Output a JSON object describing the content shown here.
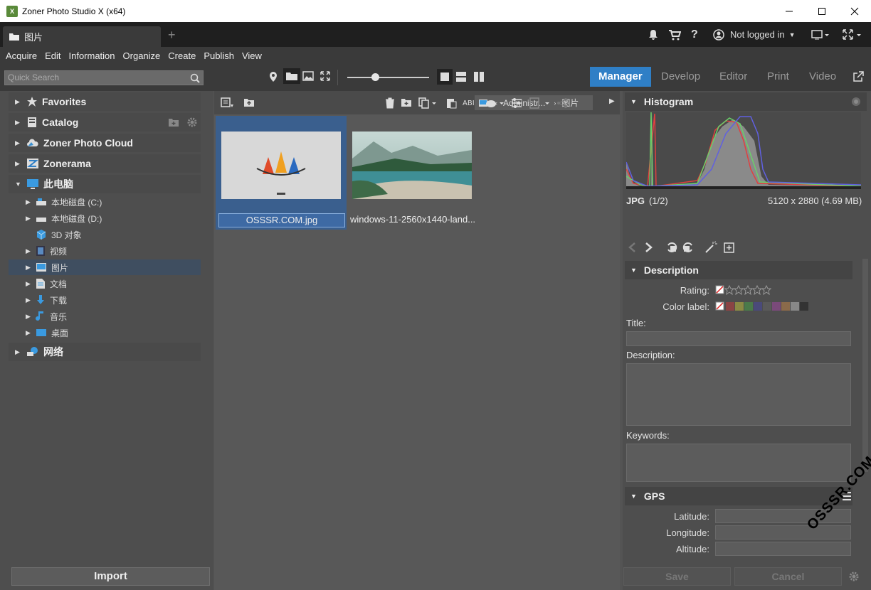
{
  "window": {
    "title": "Zoner Photo Studio X (x64)",
    "app_icon": "X"
  },
  "tab": {
    "label": "图片"
  },
  "header_right": {
    "user": "Not logged in"
  },
  "menu": [
    "Acquire",
    "Edit",
    "Information",
    "Organize",
    "Create",
    "Publish",
    "View"
  ],
  "toolbar": {
    "search_placeholder": "Quick Search"
  },
  "modes": [
    "Manager",
    "Develop",
    "Editor",
    "Print",
    "Video"
  ],
  "left": {
    "items": [
      "Favorites",
      "Catalog",
      "Zoner Photo Cloud",
      "Zonerama",
      "此电脑"
    ],
    "drives": [
      "本地磁盘 (C:)",
      "本地磁盘 (D:)",
      "3D 对象",
      "视频",
      "图片",
      "文档",
      "下载",
      "音乐",
      "桌面"
    ],
    "network": "网络",
    "import": "Import"
  },
  "breadcrumb": {
    "parent": "Administr...",
    "current": "图片"
  },
  "thumbs": [
    {
      "name": "OSSSR.COM.jpg"
    },
    {
      "name": "windows-11-2560x1440-land..."
    }
  ],
  "right": {
    "histogram": "Histogram",
    "format": "JPG",
    "index": "(1/2)",
    "dims": "5120 x 2880 (4.69 MB)",
    "description_head": "Description",
    "rating_label": "Rating:",
    "color_label": "Color label:",
    "title_label": "Title:",
    "description_label": "Description:",
    "keywords_label": "Keywords:",
    "gps_head": "GPS",
    "latitude": "Latitude:",
    "longitude": "Longitude:",
    "altitude": "Altitude:",
    "save": "Save",
    "cancel": "Cancel"
  },
  "watermark": "OSSSR.COM",
  "colors": {
    "accent": "#2f7fc6",
    "selection": "#3a5f8e"
  }
}
